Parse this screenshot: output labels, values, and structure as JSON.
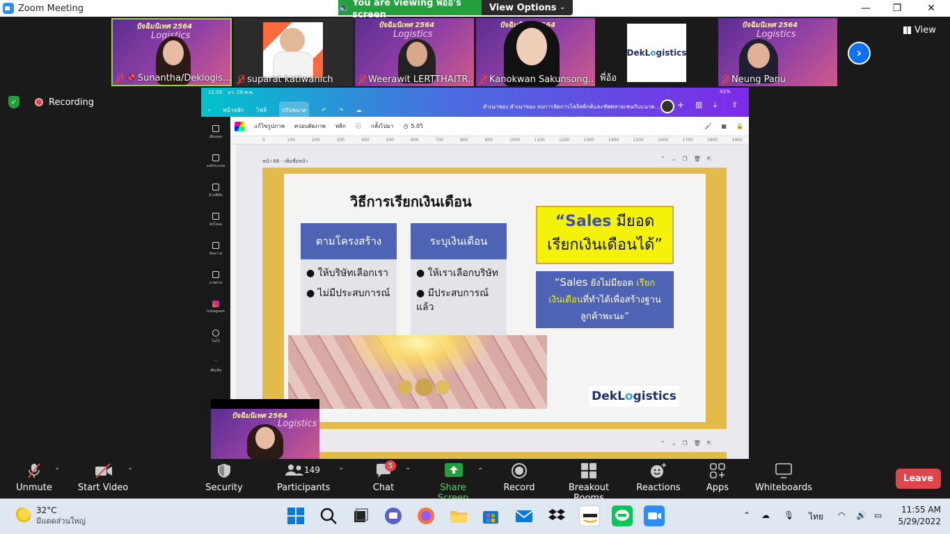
{
  "window": {
    "title": "Zoom Meeting",
    "controls": [
      "—",
      "❐",
      "✕"
    ]
  },
  "share_banner": {
    "viewing_text": "You are viewing พี่อ้อ's screen",
    "view_options": "View Options",
    "banner_color": "#23a03d"
  },
  "participants_strip": [
    {
      "name": "Sunantha/Deklogis...",
      "muted": true,
      "pinned": true
    },
    {
      "name": "suparat katiwanich",
      "muted": true
    },
    {
      "name": "Weerawit LERTTHAITR...",
      "muted": true
    },
    {
      "name": "Kanokwan Sakunsong...",
      "muted": true
    },
    {
      "name": "พี่อ้อ",
      "muted": false
    },
    {
      "name": "Neung Panu",
      "muted": true
    }
  ],
  "event_banner": {
    "header": "ปัจฉิมนิเทศ 2564",
    "sub": "Logistics"
  },
  "view_button": "View",
  "recording_label": "Recording",
  "shared_screen": {
    "status_time": "11:55",
    "status_date": "อา. 29 พ.ค.",
    "battery": "92%",
    "nav": [
      "หน้าหลัก",
      "ไฟล์",
      "ปรับขนาด"
    ],
    "doc_title": "สำเนาของ สำเนาของ จบการจัดการโลจิสติกส์และซัพพลายเชนกับแนวค...",
    "toolbar": [
      "แก้ไขรูปภาพ",
      "ครอบตัดภาพ",
      "พลิก",
      "กลั้งไปมา",
      "5.0วิ"
    ],
    "ruler_ticks": [
      "0",
      "100",
      "200",
      "300",
      "400",
      "500",
      "600",
      "700",
      "800",
      "900",
      "1000",
      "1100",
      "1200",
      "1300",
      "1400",
      "1500",
      "1600",
      "1700",
      "1800",
      "1900"
    ],
    "side_items": [
      "เพิ่มเพลง",
      "องค์ประกอบ",
      "ม้วนฟิล์ม",
      "อัปโหลด",
      "ข้อความ",
      "ภาพถ่าย",
      "Instagram",
      "โลโก้",
      "เพิ่มเติม"
    ],
    "page_label": "หน้า 66 - เพิ่มชื่อหน้า"
  },
  "slide": {
    "title": "วิธีการเรียกเงินเดือน",
    "box1_head": "ตามโครงสร้าง",
    "box1_items": [
      "ให้บริษัทเลือกเรา",
      "ไม่มีประสบการณ์"
    ],
    "box2_head": "ระบุเงินเดือน",
    "box2_items": [
      "ให้เราเลือกบริษัท",
      "มีประสบการณ์ แล้ว"
    ],
    "quote_yellow_a": "“Sales",
    "quote_yellow_b": "มียอด",
    "quote_yellow_c": "เรียกเงินเดือนได้”",
    "quote_blue_a": "“Sales",
    "quote_blue_b": "ยังไม่มียอด",
    "quote_blue_c": "เรียก",
    "quote_blue_d": "เงินเดือน",
    "quote_blue_e": "ที่ทำได้เพื่อสร้างฐาน",
    "quote_blue_f": "ลูกค้าพะนะ”",
    "logo_a": "DekL",
    "logo_b": "o",
    "logo_c": "gistics"
  },
  "thumb_logo": {
    "a": "DekL",
    "b": "o",
    "c": "gistics"
  },
  "toolbar": {
    "unmute": "Unmute",
    "start_video": "Start Video",
    "security": "Security",
    "participants": "Participants",
    "participants_count": "149",
    "chat": "Chat",
    "chat_badge": "5",
    "share_screen": "Share Screen",
    "record": "Record",
    "breakout_rooms": "Breakout Rooms",
    "reactions": "Reactions",
    "apps": "Apps",
    "whiteboards": "Whiteboards",
    "leave": "Leave",
    "leave_color": "#e0454a",
    "share_color": "#23a03d"
  },
  "taskbar": {
    "temperature": "32°C",
    "weather": "มีแดดส่วนใหญ่",
    "language": "ไทย",
    "time": "11:55 AM",
    "date": "5/29/2022"
  }
}
